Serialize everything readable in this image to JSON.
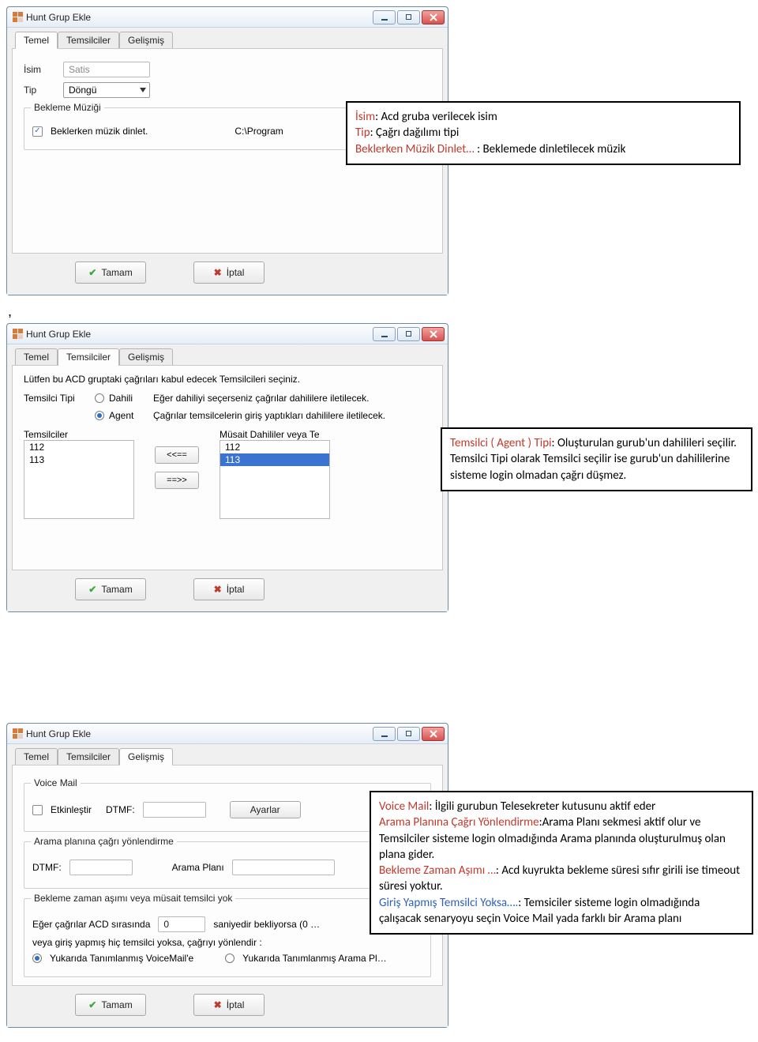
{
  "windows": {
    "title": "Hunt Grup Ekle",
    "tabs": {
      "t1": "Temel",
      "t2": "Temsilciler",
      "t3": "Gelişmiş"
    }
  },
  "buttons": {
    "ok": "Tamam",
    "cancel": "İptal",
    "ayarlar": "Ayarlar"
  },
  "transfer": {
    "left": "<<==",
    "right": "==>>"
  },
  "temel": {
    "isim_label": "İsim",
    "isim_value": "Satis",
    "tip_label": "Tip",
    "tip_value": "Döngü",
    "bekleme_group": "Bekleme Müziği",
    "bekleme_chk": "Beklerken müzik dinlet.",
    "bekleme_path": "C:\\Program"
  },
  "temsilciler": {
    "intro": "Lütfen bu ACD gruptaki çağrıları kabul edecek Temsilcileri seçiniz.",
    "type_label": "Temsilci Tipi",
    "type_opt1": "Dahili",
    "type_opt1_note": "Eğer dahiliyi seçerseniz çağrılar dahililere iletilecek.",
    "type_opt2": "Agent",
    "type_opt2_note": "Çağrılar temsilcelerin giriş yaptıkları dahililere iletilecek.",
    "left_label": "Temsilciler",
    "right_label": "Müsait Dahililer veya Te",
    "left_items": [
      "112",
      "113"
    ],
    "right_items": [
      "112",
      "113"
    ]
  },
  "gelismis": {
    "vm_group": "Voice Mail",
    "vm_enable": "Etkinleştir",
    "dtmf_label": "DTMF:",
    "ap_group": "Arama planına çağrı yönlendirme",
    "ap_label": "Arama Planı",
    "bz_group": "Bekleme zaman aşımı veya müsait temsilci yok",
    "bz_pre": "Eğer çağrılar ACD sırasında",
    "bz_val": "0",
    "bz_post": "saniyedir bekliyorsa (0 …",
    "bz_line2": "veya giriş yapmış hiç temsilci yoksa, çağrıyı yönlendir :",
    "bz_opt1": "Yukarıda Tanımlanmış VoiceMail'e",
    "bz_opt2": "Yukarıda Tanımlanmış Arama Pl…"
  },
  "callouts": {
    "c1_l1a": "İsim",
    "c1_l1b": ": Acd gruba verilecek isim",
    "c1_l2a": "Tip",
    "c1_l2b": ": Çağrı dağılımı tipi",
    "c1_l3a": "Beklerken Müzik Dinlet…",
    "c1_l3b": " : Beklemede dinletilecek müzik",
    "c2_l1a": "Temsilci ( Agent ) Tipi",
    "c2_l1b": ": Oluşturulan gurub'un dahilileri seçilir. Temsilci Tipi olarak Temsilci seçilir ise gurub'un dahililerine sisteme login olmadan çağrı düşmez.",
    "c3_l1a": "Voice Mail",
    "c3_l1b": ": İlgili gurubun Telesekreter kutusunu aktif eder",
    "c3_l2a": "Arama Planına Çağrı Yönlendirme",
    "c3_l2b": ":Arama Planı sekmesi aktif olur ve Temsilciler sisteme login olmadığında Arama planında oluşturulmuş olan plana gider.",
    "c3_l3a": "Bekleme Zaman Aşımı …",
    "c3_l3b": ": Acd kuyrukta bekleme süresi  sıfır girili ise timeout süresi yoktur.",
    "c3_l4a": "Giriş Yapmış Temsilci Yoksa….",
    "c3_l4b": ": Temsiciler sisteme login olmadığında çalışacak senaryoyu seçin Voice Mail  yada farklı bir Arama planı"
  }
}
